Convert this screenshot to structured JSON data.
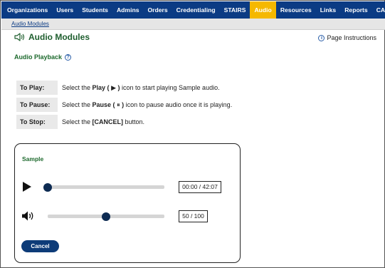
{
  "nav": {
    "items": [
      {
        "label": "Organizations"
      },
      {
        "label": "Users"
      },
      {
        "label": "Students"
      },
      {
        "label": "Admins"
      },
      {
        "label": "Orders"
      },
      {
        "label": "Credentialing"
      },
      {
        "label": "STAIRS"
      },
      {
        "label": "Audio",
        "active": true
      },
      {
        "label": "Resources"
      },
      {
        "label": "Links"
      },
      {
        "label": "Reports"
      },
      {
        "label": "CARS"
      }
    ],
    "active_color": "#f5b800",
    "bar_color": "#0b3b84"
  },
  "breadcrumb": {
    "label": "Audio Modules"
  },
  "page": {
    "title": "Audio Modules",
    "title_icon": "speaker-icon",
    "instructions_label": "Page Instructions"
  },
  "section": {
    "title": "Audio Playback"
  },
  "instructions": {
    "play": {
      "label": "To Play:",
      "pre": "Select the ",
      "bold": "Play (",
      "glyph": "▶",
      "bold2": ")",
      "post": " icon to start playing Sample audio."
    },
    "pause": {
      "label": "To Pause:",
      "pre": "Select the ",
      "bold": "Pause (",
      "glyph": "⏸",
      "bold2": ")",
      "post": " icon to pause audio once it is playing."
    },
    "stop": {
      "label": "To Stop:",
      "pre": "Select the ",
      "bold": "[CANCEL]",
      "post": " button."
    }
  },
  "player": {
    "title": "Sample",
    "time_readout": "00:00 / 42:07",
    "progress_fraction": 0.0,
    "volume_readout": "50 / 100",
    "volume_fraction": 0.5,
    "cancel_label": "Cancel"
  }
}
